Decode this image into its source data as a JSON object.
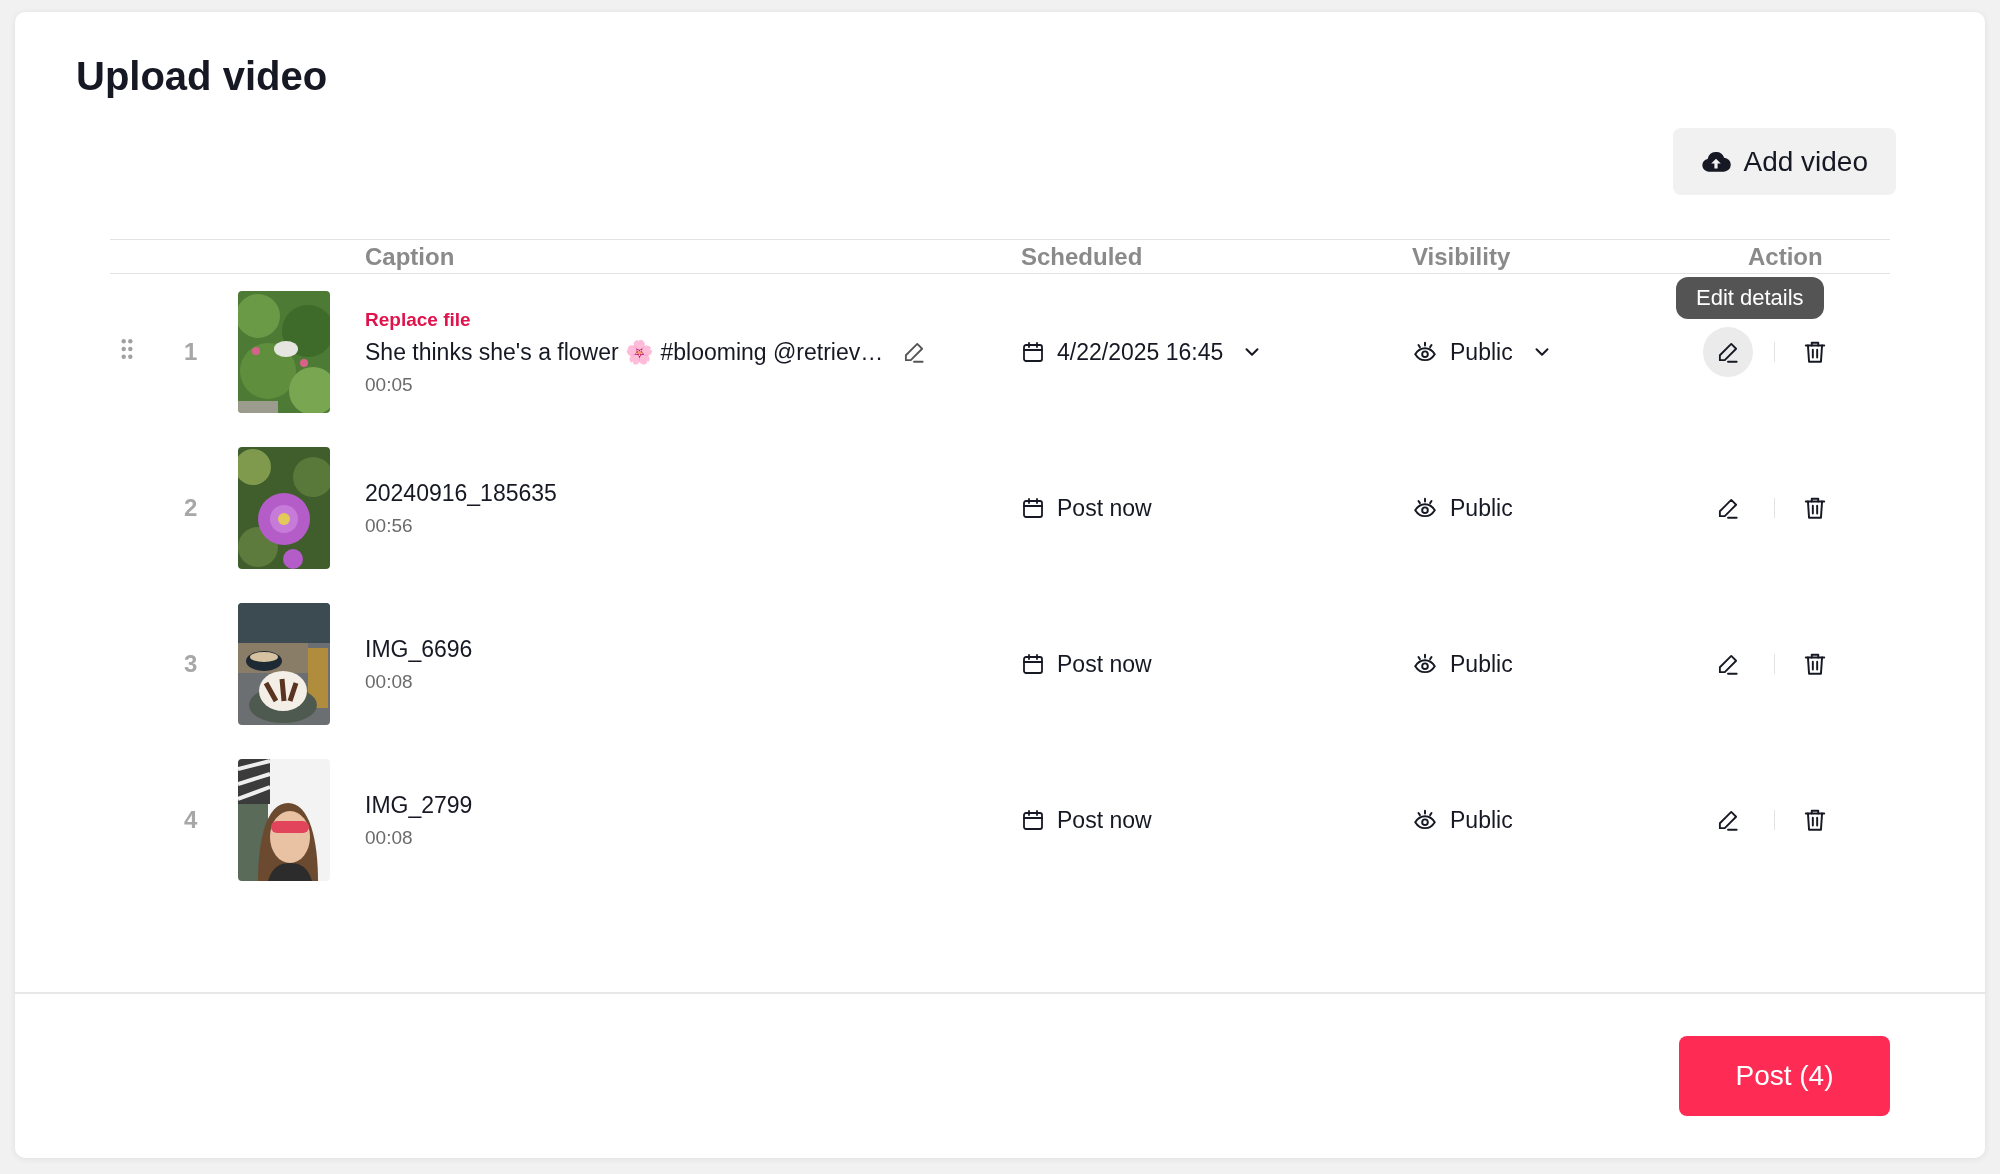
{
  "title": "Upload video",
  "add_button": "Add video",
  "columns": [
    "Caption",
    "Scheduled",
    "Visibility",
    "Action"
  ],
  "rows": [
    {
      "number": "1",
      "hovered": true,
      "replace_label": "Replace file",
      "caption": "She thinks she's a flower 🌸 #blooming @retriev…",
      "caption_editable": true,
      "duration": "00:05",
      "schedule": "4/22/2025 16:45",
      "schedule_dropdown": true,
      "visibility": "Public",
      "visibility_dropdown": true,
      "edit_highlighted": true,
      "edit_tooltip": "Edit details"
    },
    {
      "number": "2",
      "hovered": false,
      "caption": "20240916_185635",
      "caption_editable": false,
      "duration": "00:56",
      "schedule": "Post now",
      "schedule_dropdown": false,
      "visibility": "Public",
      "visibility_dropdown": false,
      "edit_highlighted": false
    },
    {
      "number": "3",
      "hovered": false,
      "caption": "IMG_6696",
      "caption_editable": false,
      "duration": "00:08",
      "schedule": "Post now",
      "schedule_dropdown": false,
      "visibility": "Public",
      "visibility_dropdown": false,
      "edit_highlighted": false
    },
    {
      "number": "4",
      "hovered": false,
      "caption": "IMG_2799",
      "caption_editable": false,
      "duration": "00:08",
      "schedule": "Post now",
      "schedule_dropdown": false,
      "visibility": "Public",
      "visibility_dropdown": false,
      "edit_highlighted": false
    }
  ],
  "post_button": "Post (4)"
}
